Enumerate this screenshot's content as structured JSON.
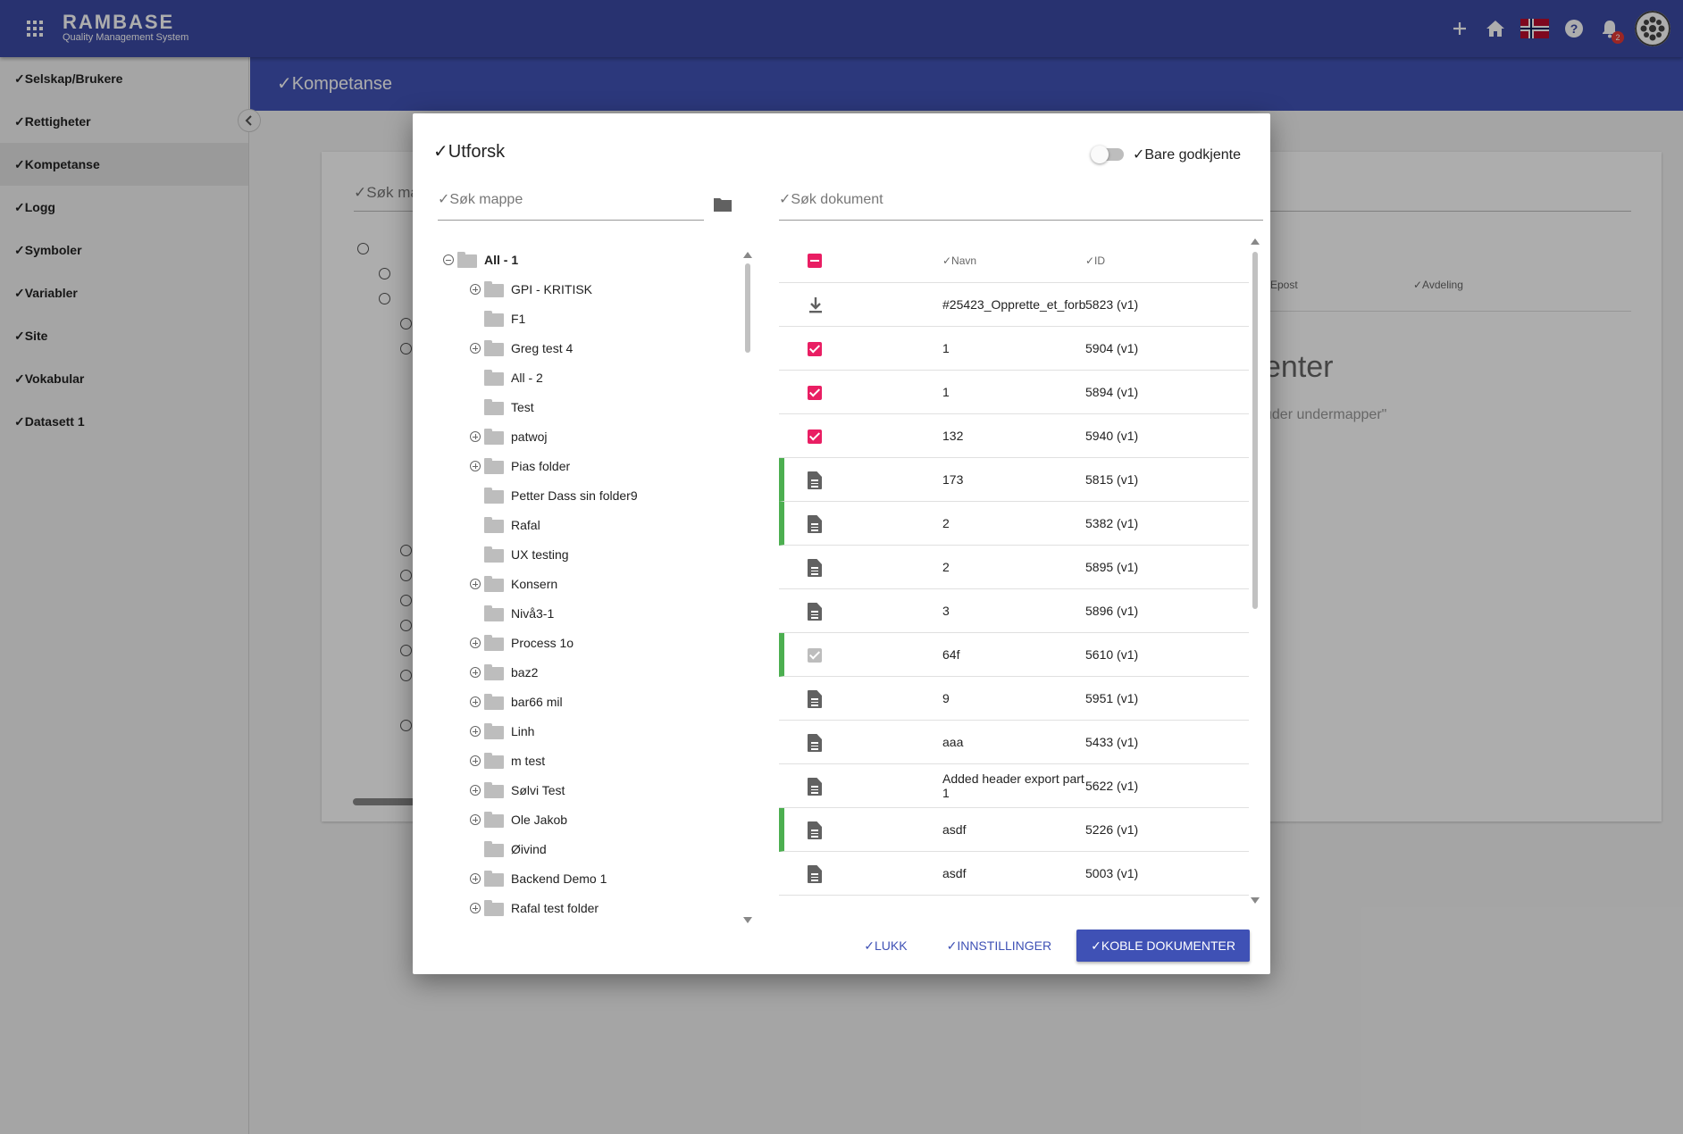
{
  "topbar": {
    "brand": "RAMBASE",
    "subtitle": "Quality Management System",
    "notification_count": "2"
  },
  "sidebar": {
    "items": [
      {
        "label": "✓Selskap/Brukere"
      },
      {
        "label": "✓Rettigheter"
      },
      {
        "label": "✓Kompetanse"
      },
      {
        "label": "✓Logg"
      },
      {
        "label": "✓Symboler"
      },
      {
        "label": "✓Variabler"
      },
      {
        "label": "✓Site"
      },
      {
        "label": "✓Vokabular"
      },
      {
        "label": "✓Datasett 1"
      }
    ]
  },
  "page": {
    "title": "✓Kompetanse",
    "search_placeholder": "✓Søk ma",
    "col_epost": "Epost",
    "col_avdeling": "✓Avdeling",
    "empty_title": "enter",
    "empty_sub": "uder undermapper\""
  },
  "dialog": {
    "title": "✓Utforsk",
    "toggle_label": "✓Bare godkjente",
    "folder_search_placeholder": "✓Søk mappe",
    "doc_search_placeholder": "✓Søk dokument",
    "tree": [
      {
        "label": "All - 1",
        "level": 0,
        "expander": "minus",
        "bold": true
      },
      {
        "label": "GPI - KRITISK",
        "level": 1,
        "expander": "plus"
      },
      {
        "label": "F1",
        "level": 1,
        "expander": ""
      },
      {
        "label": "Greg test 4",
        "level": 1,
        "expander": "plus"
      },
      {
        "label": "All - 2",
        "level": 1,
        "expander": ""
      },
      {
        "label": "Test",
        "level": 1,
        "expander": ""
      },
      {
        "label": "patwoj",
        "level": 1,
        "expander": "plus"
      },
      {
        "label": "Pias folder",
        "level": 1,
        "expander": "plus"
      },
      {
        "label": "Petter Dass sin folder9",
        "level": 1,
        "expander": ""
      },
      {
        "label": "Rafal",
        "level": 1,
        "expander": ""
      },
      {
        "label": "UX testing",
        "level": 1,
        "expander": ""
      },
      {
        "label": "Konsern",
        "level": 1,
        "expander": "plus"
      },
      {
        "label": "Nivå3-1",
        "level": 1,
        "expander": ""
      },
      {
        "label": "Process 1o",
        "level": 1,
        "expander": "plus"
      },
      {
        "label": "baz2",
        "level": 1,
        "expander": "plus"
      },
      {
        "label": "bar66 mil",
        "level": 1,
        "expander": "plus"
      },
      {
        "label": "Linh",
        "level": 1,
        "expander": "plus"
      },
      {
        "label": "m test",
        "level": 1,
        "expander": "plus"
      },
      {
        "label": "Sølvi Test",
        "level": 1,
        "expander": "plus"
      },
      {
        "label": "Ole Jakob",
        "level": 1,
        "expander": "plus"
      },
      {
        "label": "Øivind",
        "level": 1,
        "expander": ""
      },
      {
        "label": "Backend Demo 1",
        "level": 1,
        "expander": "plus"
      },
      {
        "label": "Rafal test folder",
        "level": 1,
        "expander": "plus"
      }
    ],
    "table": {
      "col_name": "✓Navn",
      "col_id": "✓ID",
      "rows": [
        {
          "icon": "download",
          "name": "#25423_Opprette_et_forb",
          "id": "5823 (v1)",
          "green": false
        },
        {
          "icon": "checked",
          "name": "1",
          "id": "5904 (v1)",
          "green": false
        },
        {
          "icon": "checked",
          "name": "1",
          "id": "5894 (v1)",
          "green": false
        },
        {
          "icon": "checked",
          "name": "132",
          "id": "5940 (v1)",
          "green": false
        },
        {
          "icon": "doc",
          "name": "173",
          "id": "5815 (v1)",
          "green": true
        },
        {
          "icon": "doc",
          "name": "2",
          "id": "5382 (v1)",
          "green": true
        },
        {
          "icon": "doc",
          "name": "2",
          "id": "5895 (v1)",
          "green": false
        },
        {
          "icon": "doc",
          "name": "3",
          "id": "5896 (v1)",
          "green": false
        },
        {
          "icon": "checked-disabled",
          "name": "64f",
          "id": "5610 (v1)",
          "green": true
        },
        {
          "icon": "doc",
          "name": "9",
          "id": "5951 (v1)",
          "green": false
        },
        {
          "icon": "doc",
          "name": "aaa",
          "id": "5433 (v1)",
          "green": false
        },
        {
          "icon": "doc",
          "name": "Added header export part 1",
          "id": "5622 (v1)",
          "green": false
        },
        {
          "icon": "doc",
          "name": "asdf",
          "id": "5226 (v1)",
          "green": true
        },
        {
          "icon": "doc",
          "name": "asdf",
          "id": "5003 (v1)",
          "green": false
        }
      ]
    },
    "buttons": {
      "close": "✓LUKK",
      "settings": "✓INNSTILLINGER",
      "link": "✓KOBLE DOKUMENTER"
    }
  }
}
